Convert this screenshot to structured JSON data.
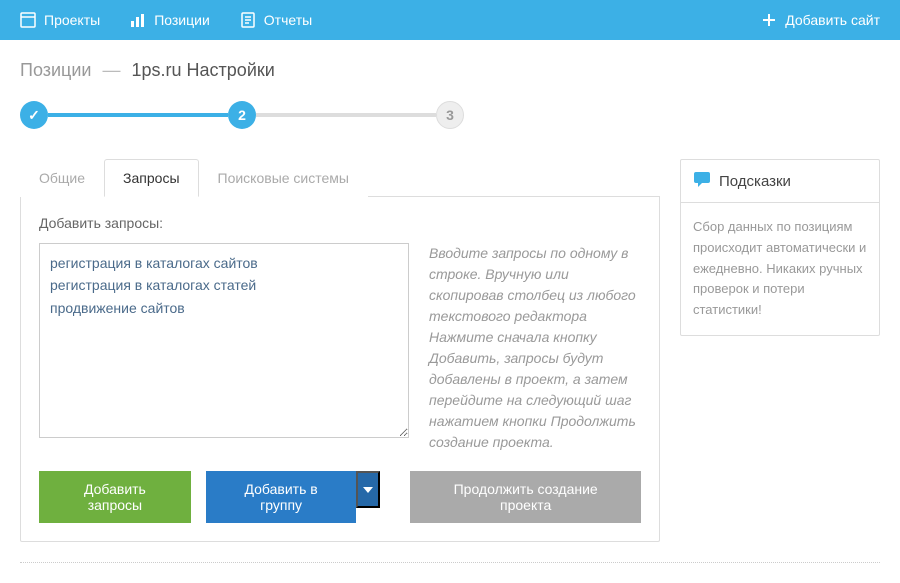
{
  "nav": {
    "projects": "Проекты",
    "positions": "Позиции",
    "reports": "Отчеты",
    "add_site": "Добавить сайт"
  },
  "breadcrumb": {
    "root": "Позиции",
    "sep": "—",
    "current": "1ps.ru Настройки"
  },
  "stepper": {
    "step2": "2",
    "step3": "3"
  },
  "tabs": {
    "general": "Общие",
    "queries": "Запросы",
    "search_systems": "Поисковые системы"
  },
  "panel": {
    "label": "Добавить запросы:",
    "textarea_value": "регистрация в каталогах сайтов\nрегистрация в каталогах статей\nпродвижение сайтов",
    "hint1": "Вводите запросы по одному в строке. Вручную или скопировав столбец из любого текстового редактора",
    "hint2": "Нажмите сначала кнопку Добавить, запросы будут добавлены в проект, а затем перейдите на следующий шаг нажатием кнопки Продолжить создание проекта."
  },
  "buttons": {
    "add_queries": "Добавить запросы",
    "add_to_group": "Добавить в группу",
    "continue": "Продолжить создание проекта"
  },
  "hints": {
    "title": "Подсказки",
    "body": "Сбор данных по позициям происходит автоматически и ежедневно. Никаких ручных проверок и потери статистики!"
  }
}
